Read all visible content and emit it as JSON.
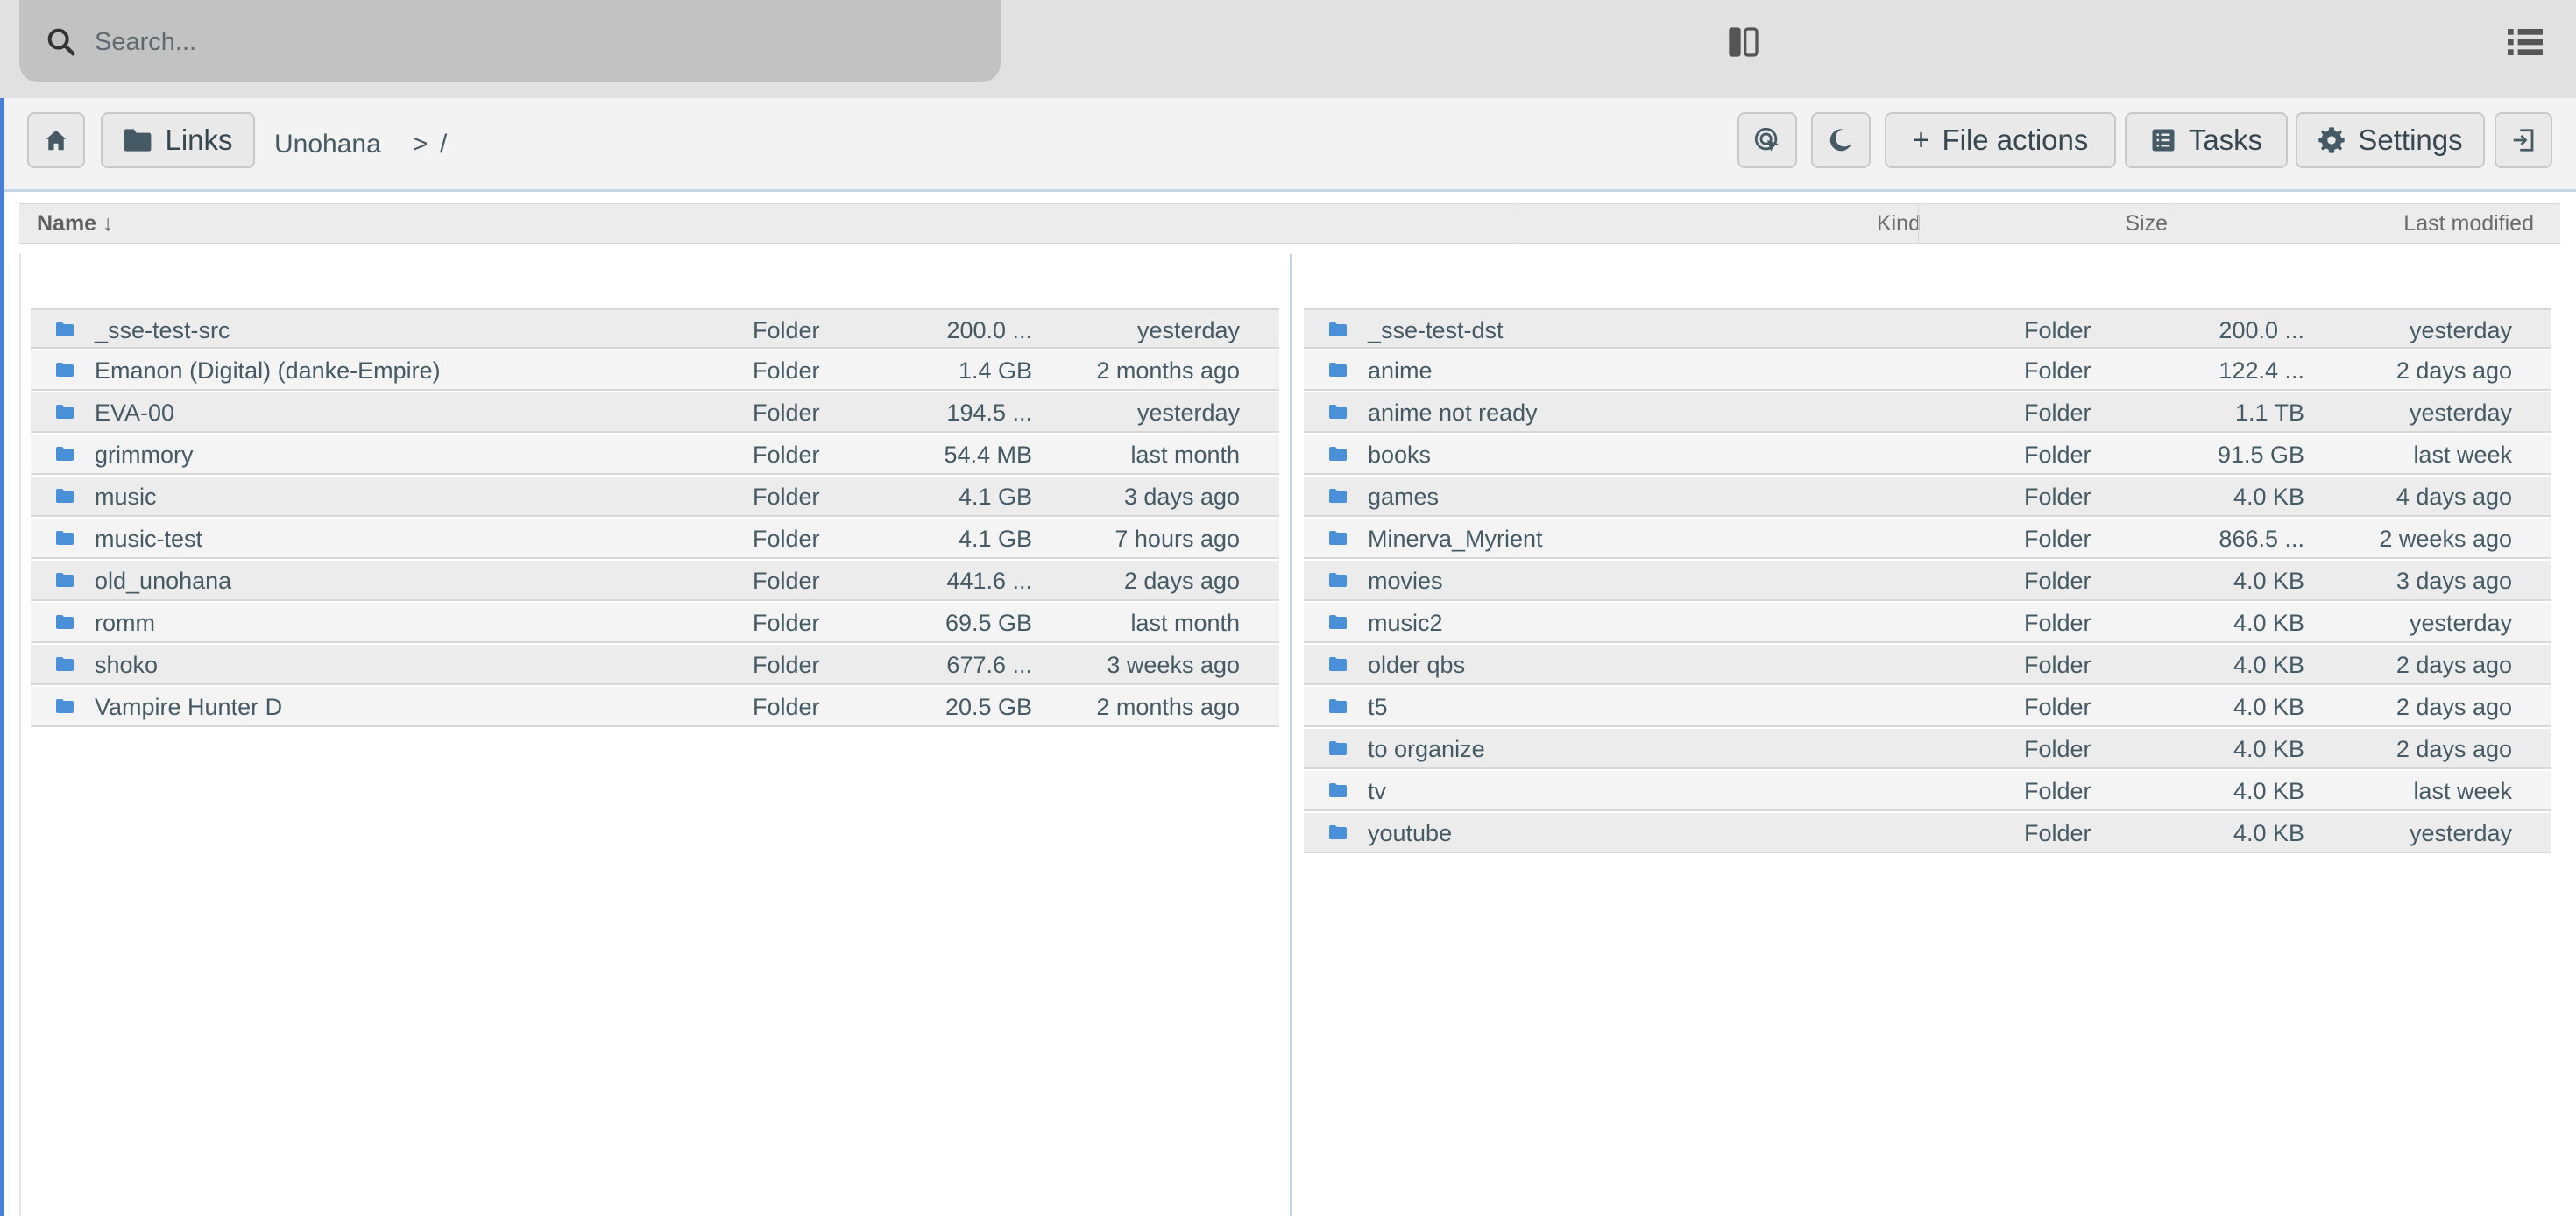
{
  "search": {
    "placeholder": "Search..."
  },
  "toolbar": {
    "links_label": "Links",
    "breadcrumb_root": "Unohana",
    "breadcrumb_sep": ">",
    "breadcrumb_path": "/",
    "file_actions_label": "File actions",
    "tasks_label": "Tasks",
    "settings_label": "Settings"
  },
  "columns": {
    "name": "Name",
    "sort_indicator": "↓",
    "kind": "Kind",
    "size": "Size",
    "modified": "Last modified"
  },
  "colors": {
    "folder_icon": "#4a90d9",
    "accent": "#4a7fd8"
  },
  "left_pane": {
    "rows": [
      {
        "name": "_sse-test-src",
        "kind": "Folder",
        "size": "200.0 ...",
        "modified": "yesterday"
      },
      {
        "name": "Emanon (Digital) (danke-Empire)",
        "kind": "Folder",
        "size": "1.4 GB",
        "modified": "2 months ago"
      },
      {
        "name": "EVA-00",
        "kind": "Folder",
        "size": "194.5 ...",
        "modified": "yesterday"
      },
      {
        "name": "grimmory",
        "kind": "Folder",
        "size": "54.4 MB",
        "modified": "last month"
      },
      {
        "name": "music",
        "kind": "Folder",
        "size": "4.1 GB",
        "modified": "3 days ago"
      },
      {
        "name": "music-test",
        "kind": "Folder",
        "size": "4.1 GB",
        "modified": "7 hours ago"
      },
      {
        "name": "old_unohana",
        "kind": "Folder",
        "size": "441.6 ...",
        "modified": "2 days ago"
      },
      {
        "name": "romm",
        "kind": "Folder",
        "size": "69.5 GB",
        "modified": "last month"
      },
      {
        "name": "shoko",
        "kind": "Folder",
        "size": "677.6 ...",
        "modified": "3 weeks ago"
      },
      {
        "name": "Vampire Hunter D",
        "kind": "Folder",
        "size": "20.5 GB",
        "modified": "2 months ago"
      }
    ]
  },
  "right_pane": {
    "rows": [
      {
        "name": "_sse-test-dst",
        "kind": "Folder",
        "size": "200.0 ...",
        "modified": "yesterday"
      },
      {
        "name": "anime",
        "kind": "Folder",
        "size": "122.4 ...",
        "modified": "2 days ago"
      },
      {
        "name": "anime not ready",
        "kind": "Folder",
        "size": "1.1 TB",
        "modified": "yesterday"
      },
      {
        "name": "books",
        "kind": "Folder",
        "size": "91.5 GB",
        "modified": "last week"
      },
      {
        "name": "games",
        "kind": "Folder",
        "size": "4.0 KB",
        "modified": "4 days ago"
      },
      {
        "name": "Minerva_Myrient",
        "kind": "Folder",
        "size": "866.5 ...",
        "modified": "2 weeks ago"
      },
      {
        "name": "movies",
        "kind": "Folder",
        "size": "4.0 KB",
        "modified": "3 days ago"
      },
      {
        "name": "music2",
        "kind": "Folder",
        "size": "4.0 KB",
        "modified": "yesterday"
      },
      {
        "name": "older qbs",
        "kind": "Folder",
        "size": "4.0 KB",
        "modified": "2 days ago"
      },
      {
        "name": "t5",
        "kind": "Folder",
        "size": "4.0 KB",
        "modified": "2 days ago"
      },
      {
        "name": "to organize",
        "kind": "Folder",
        "size": "4.0 KB",
        "modified": "2 days ago"
      },
      {
        "name": "tv",
        "kind": "Folder",
        "size": "4.0 KB",
        "modified": "last week"
      },
      {
        "name": "youtube",
        "kind": "Folder",
        "size": "4.0 KB",
        "modified": "yesterday"
      }
    ]
  }
}
